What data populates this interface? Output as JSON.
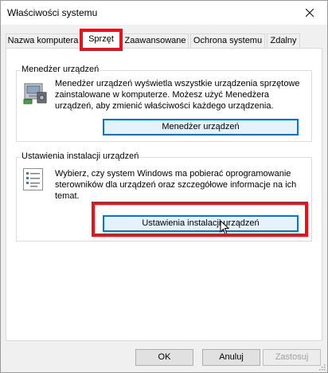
{
  "window": {
    "title": "Właściwości systemu"
  },
  "tabs": [
    {
      "label": "Nazwa komputera"
    },
    {
      "label": "Sprzęt"
    },
    {
      "label": "Zaawansowane"
    },
    {
      "label": "Ochrona systemu"
    },
    {
      "label": "Zdalny"
    }
  ],
  "active_tab": "Sprzęt",
  "device_manager": {
    "title": "Menedżer urządzeń",
    "description": "Menedżer urządzeń wyświetla wszystkie urządzenia sprzętowe zainstalowane w komputerze. Możesz użyć Menedżera urządzeń, aby zmienić właściwości każdego urządzenia.",
    "button_label": "Menedżer urządzeń",
    "icon": "device-manager-icon"
  },
  "install_settings": {
    "title": "Ustawienia instalacji urządzeń",
    "description": "Wybierz, czy system Windows ma pobierać oprogramowanie sterowników dla urządzeń oraz szczegółowe informacje na ich temat.",
    "button_label": "Ustawienia instalacji urządzeń",
    "icon": "device-install-settings-icon"
  },
  "footer": {
    "ok_label": "OK",
    "cancel_label": "Anuluj",
    "apply_label": "Zastosuj"
  },
  "highlight_color": "#e8121c",
  "accent_color": "#0078d7"
}
